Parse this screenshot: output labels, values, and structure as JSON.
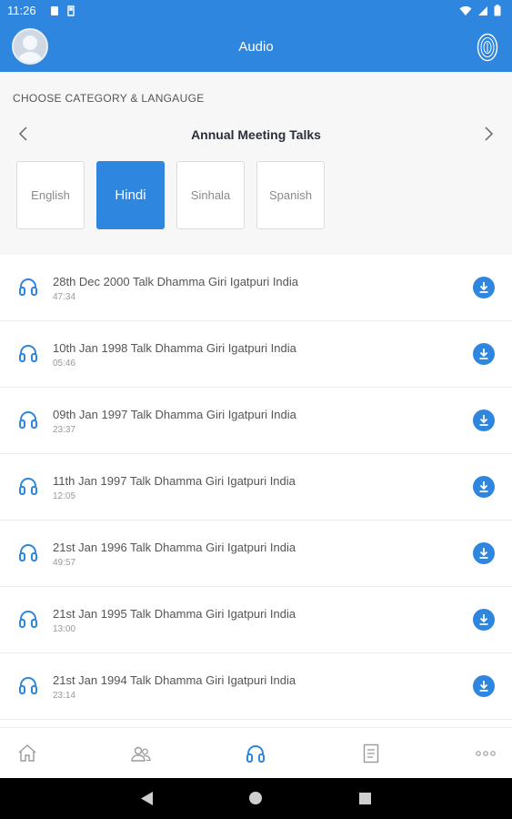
{
  "status_bar": {
    "time": "11:26"
  },
  "app_bar": {
    "title": "Audio"
  },
  "category": {
    "section_label": "CHOOSE CATEGORY & LANGAUGE",
    "title": "Annual Meeting Talks",
    "languages": [
      {
        "label": "English",
        "selected": false
      },
      {
        "label": "Hindi",
        "selected": true
      },
      {
        "label": "Sinhala",
        "selected": false
      },
      {
        "label": "Spanish",
        "selected": false
      }
    ]
  },
  "audio_items": [
    {
      "title": "28th Dec 2000 Talk Dhamma Giri Igatpuri India",
      "duration": "47:34"
    },
    {
      "title": "10th Jan 1998 Talk Dhamma Giri Igatpuri India",
      "duration": "05:46"
    },
    {
      "title": "09th Jan 1997 Talk Dhamma Giri Igatpuri India",
      "duration": "23:37"
    },
    {
      "title": "11th Jan 1997 Talk Dhamma Giri Igatpuri India",
      "duration": "12:05"
    },
    {
      "title": "21st Jan 1996 Talk Dhamma Giri Igatpuri India",
      "duration": "49:57"
    },
    {
      "title": "21st Jan 1995 Talk Dhamma Giri Igatpuri India",
      "duration": "13:00"
    },
    {
      "title": "21st Jan 1994 Talk Dhamma Giri Igatpuri India",
      "duration": "23:14"
    }
  ],
  "bottom_nav": {
    "items": [
      "home-icon",
      "people-icon",
      "headphones-icon",
      "document-icon",
      "more-icon"
    ],
    "active": "headphones-icon"
  },
  "colors": {
    "primary": "#2e86de",
    "background": "#f7f7f7"
  }
}
